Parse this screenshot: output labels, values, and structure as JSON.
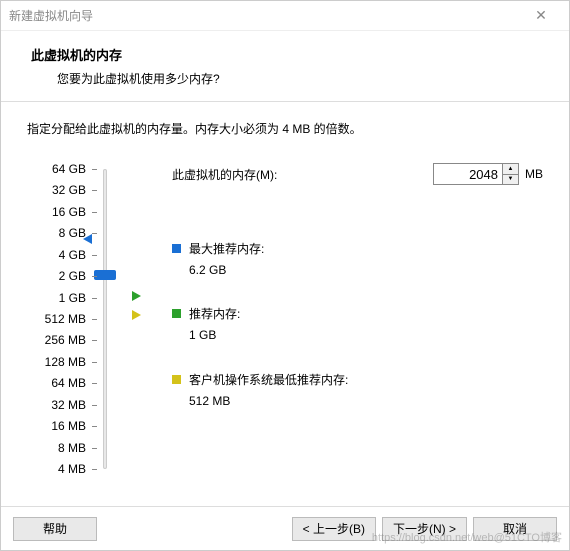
{
  "window": {
    "title": "新建虚拟机向导"
  },
  "header": {
    "title": "此虚拟机的内存",
    "subtitle": "您要为此虚拟机使用多少内存?"
  },
  "instruction": "指定分配给此虚拟机的内存量。内存大小必须为 4 MB 的倍数。",
  "memory": {
    "label": "此虚拟机的内存(M):",
    "value": "2048",
    "unit": "MB"
  },
  "slider": {
    "ticks": [
      "64 GB",
      "32 GB",
      "16 GB",
      "8 GB",
      "4 GB",
      "2 GB",
      "1 GB",
      "512 MB",
      "256 MB",
      "128 MB",
      "64 MB",
      "32 MB",
      "16 MB",
      "8 MB",
      "4 MB"
    ],
    "selected": "2 GB"
  },
  "recommend": {
    "max": {
      "title": "最大推荐内存:",
      "value": "6.2 GB"
    },
    "rec": {
      "title": "推荐内存:",
      "value": "1 GB"
    },
    "min": {
      "title": "客户机操作系统最低推荐内存:",
      "value": "512 MB"
    }
  },
  "buttons": {
    "help": "帮助",
    "back": "< 上一步(B)",
    "next": "下一步(N) >",
    "cancel": "取消"
  },
  "watermark": "https://blog.csdn.net/web@51CTO博客"
}
